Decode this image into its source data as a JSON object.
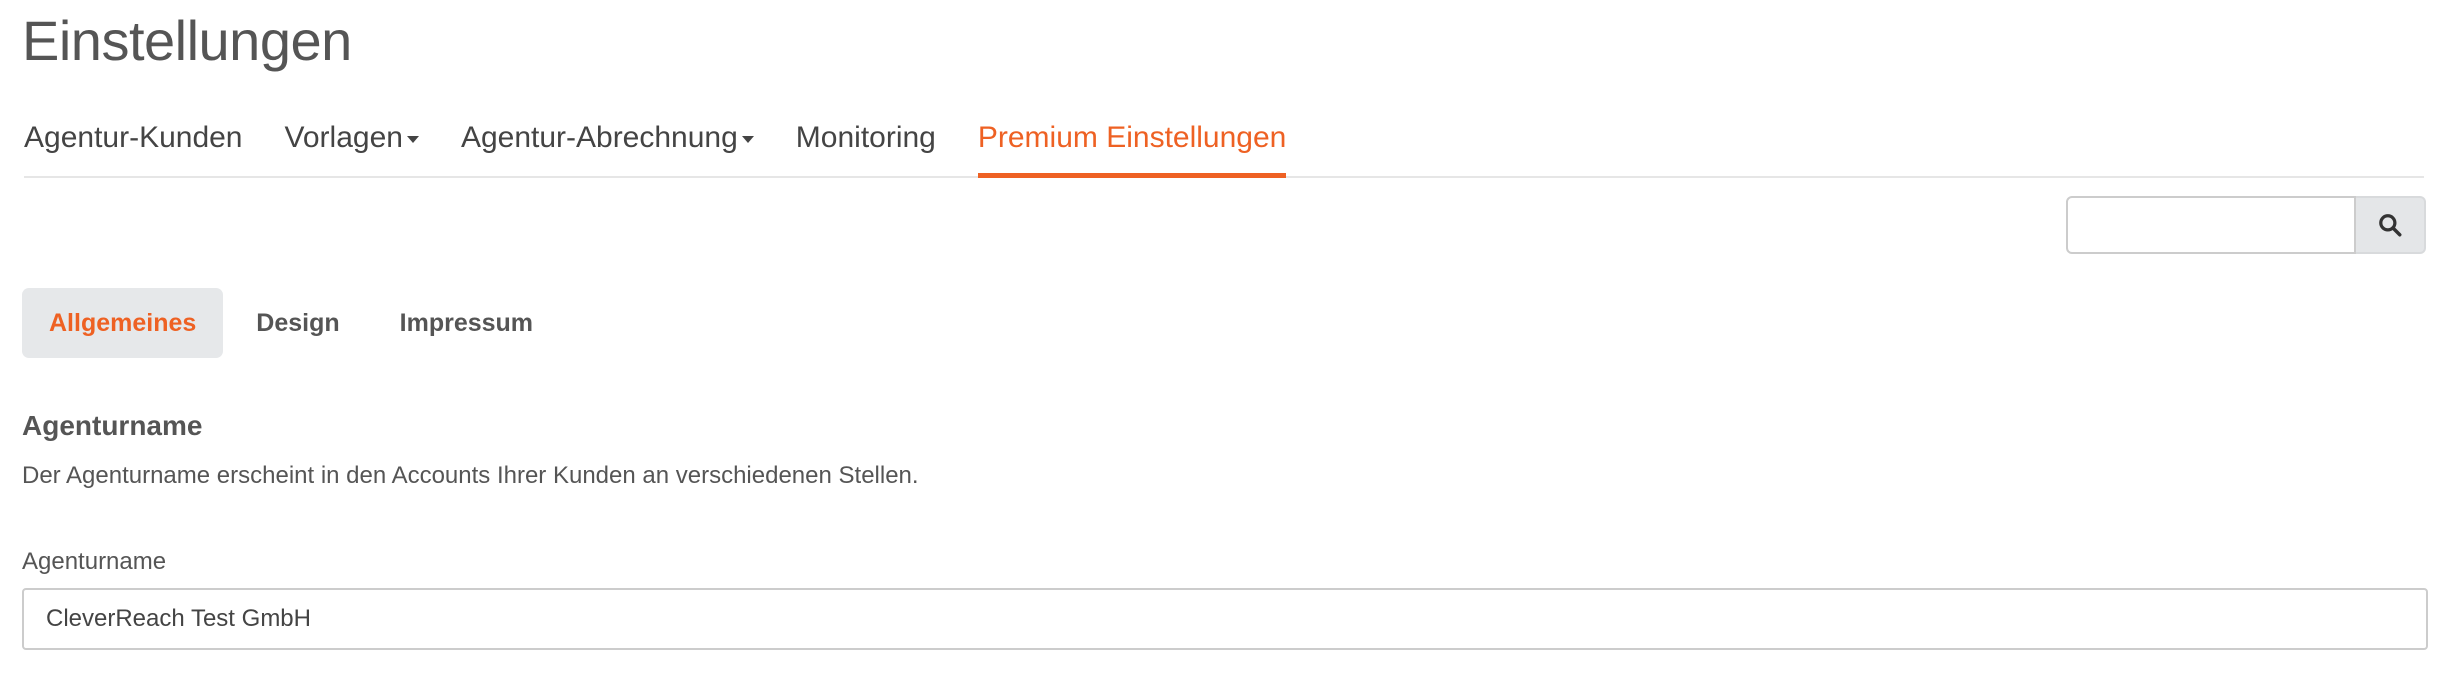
{
  "page": {
    "title": "Einstellungen"
  },
  "main_tabs": [
    {
      "label": "Agentur-Kunden",
      "dropdown": false
    },
    {
      "label": "Vorlagen",
      "dropdown": true
    },
    {
      "label": "Agentur-Abrechnung",
      "dropdown": true
    },
    {
      "label": "Monitoring",
      "dropdown": false
    },
    {
      "label": "Premium Einstellungen",
      "dropdown": false,
      "active": true
    }
  ],
  "search": {
    "value": "",
    "placeholder": "",
    "icon": "search-icon"
  },
  "sub_tabs": [
    {
      "label": "Allgemeines",
      "active": true
    },
    {
      "label": "Design"
    },
    {
      "label": "Impressum"
    }
  ],
  "section": {
    "heading": "Agenturname",
    "description": "Der Agenturname erscheint in den Accounts Ihrer Kunden an verschiedenen Stellen.",
    "field_label": "Agenturname",
    "field_value": "CleverReach Test GmbH"
  },
  "colors": {
    "accent": "#ee6123",
    "text": "#555555",
    "active_subtab_bg": "#e6e8ea"
  }
}
